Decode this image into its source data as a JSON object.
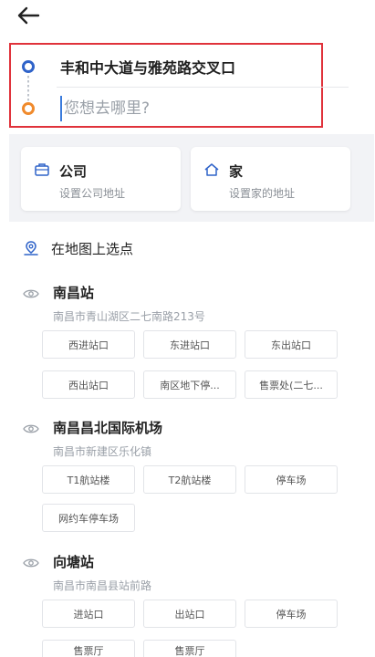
{
  "route": {
    "from": "丰和中大道与雅苑路交叉口",
    "to_placeholder": "您想去哪里?"
  },
  "shortcuts": [
    {
      "title": "公司",
      "subtitle": "设置公司地址"
    },
    {
      "title": "家",
      "subtitle": "设置家的地址"
    }
  ],
  "map_pick": {
    "label": "在地图上选点"
  },
  "pois": [
    {
      "name": "南昌站",
      "address": "南昌市青山湖区二七南路213号",
      "chips": [
        "西进站口",
        "东进站口",
        "东出站口",
        "西出站口",
        "南区地下停...",
        "售票处(二七..."
      ]
    },
    {
      "name": "南昌昌北国际机场",
      "address": "南昌市新建区乐化镇",
      "chips": [
        "T1航站楼",
        "T2航站楼",
        "停车场",
        "网约车停车场"
      ]
    },
    {
      "name": "向塘站",
      "address": "南昌市南昌县站前路",
      "chips": [
        "进站口",
        "出站口",
        "停车场",
        "售票厅",
        "售票厅"
      ]
    }
  ],
  "colors": {
    "accent": "#2f63c9",
    "origin": "#2f63c9",
    "destination": "#f08a2c",
    "highlight_border": "#e0323b"
  }
}
